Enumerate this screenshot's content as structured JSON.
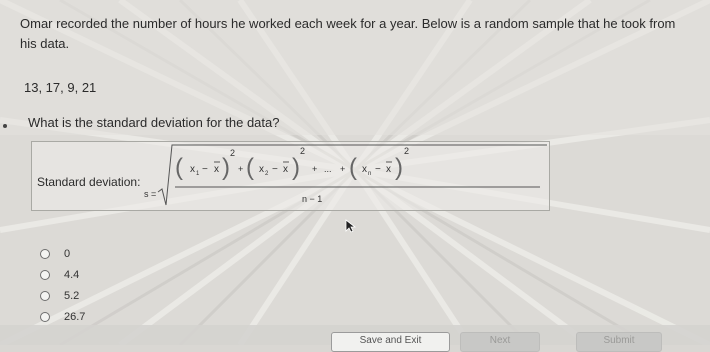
{
  "problem": {
    "text": "Omar recorded the number of hours he worked each week for a year. Below is a random sample that he took from his data.",
    "sample": "13, 17, 9, 21",
    "question": "What is the standard deviation for the data?"
  },
  "formula": {
    "label": "Standard deviation:",
    "s": "s",
    "equals": "=",
    "x1": "x",
    "x2": "x",
    "xn": "x",
    "sub1": "1",
    "sub2": "2",
    "subn": "n",
    "xbar": "x",
    "minus": "−",
    "plus": "+",
    "ellipsis": "...",
    "square": "2",
    "denominator": "n − 1"
  },
  "choices": [
    {
      "label": "0"
    },
    {
      "label": "4.4"
    },
    {
      "label": "5.2"
    },
    {
      "label": "26.7"
    }
  ],
  "buttons": {
    "save_exit": "Save and Exit",
    "next": "Next",
    "submit": "Submit"
  }
}
